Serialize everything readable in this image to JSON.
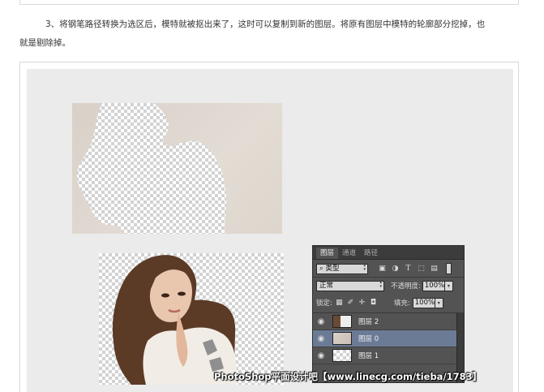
{
  "article": {
    "line1": "3、将钢笔路径转换为选区后，模特就被抠出来了，这时可以复制到新的图层。将原有图层中模特的轮廓部分挖掉，也",
    "line2": "就是剔除掉。"
  },
  "layers_panel": {
    "tabs": [
      "图层",
      "通道",
      "路径"
    ],
    "filter_kind": "类型",
    "filter_icons": [
      "image-filter-icon",
      "adjustment-filter-icon",
      "type-filter-icon",
      "shape-filter-icon",
      "smart-object-filter-icon"
    ],
    "blend_mode": "正常",
    "opacity_label": "不透明度:",
    "opacity_value": "100%",
    "lock_label": "锁定:",
    "fill_label": "填充:",
    "fill_value": "100%",
    "layers": [
      {
        "name": "图层 2",
        "visible": true,
        "selected": false
      },
      {
        "name": "图层 0",
        "visible": true,
        "selected": true
      },
      {
        "name": "图层 1",
        "visible": true,
        "selected": false
      }
    ],
    "colors": {
      "panel_bg": "#535353",
      "selected_layer": "#6b7b96",
      "tab_bar": "#3c3c3c"
    }
  },
  "watermark": "PhotoShop平面设计吧【www.linecg.com/tieba/1783】"
}
